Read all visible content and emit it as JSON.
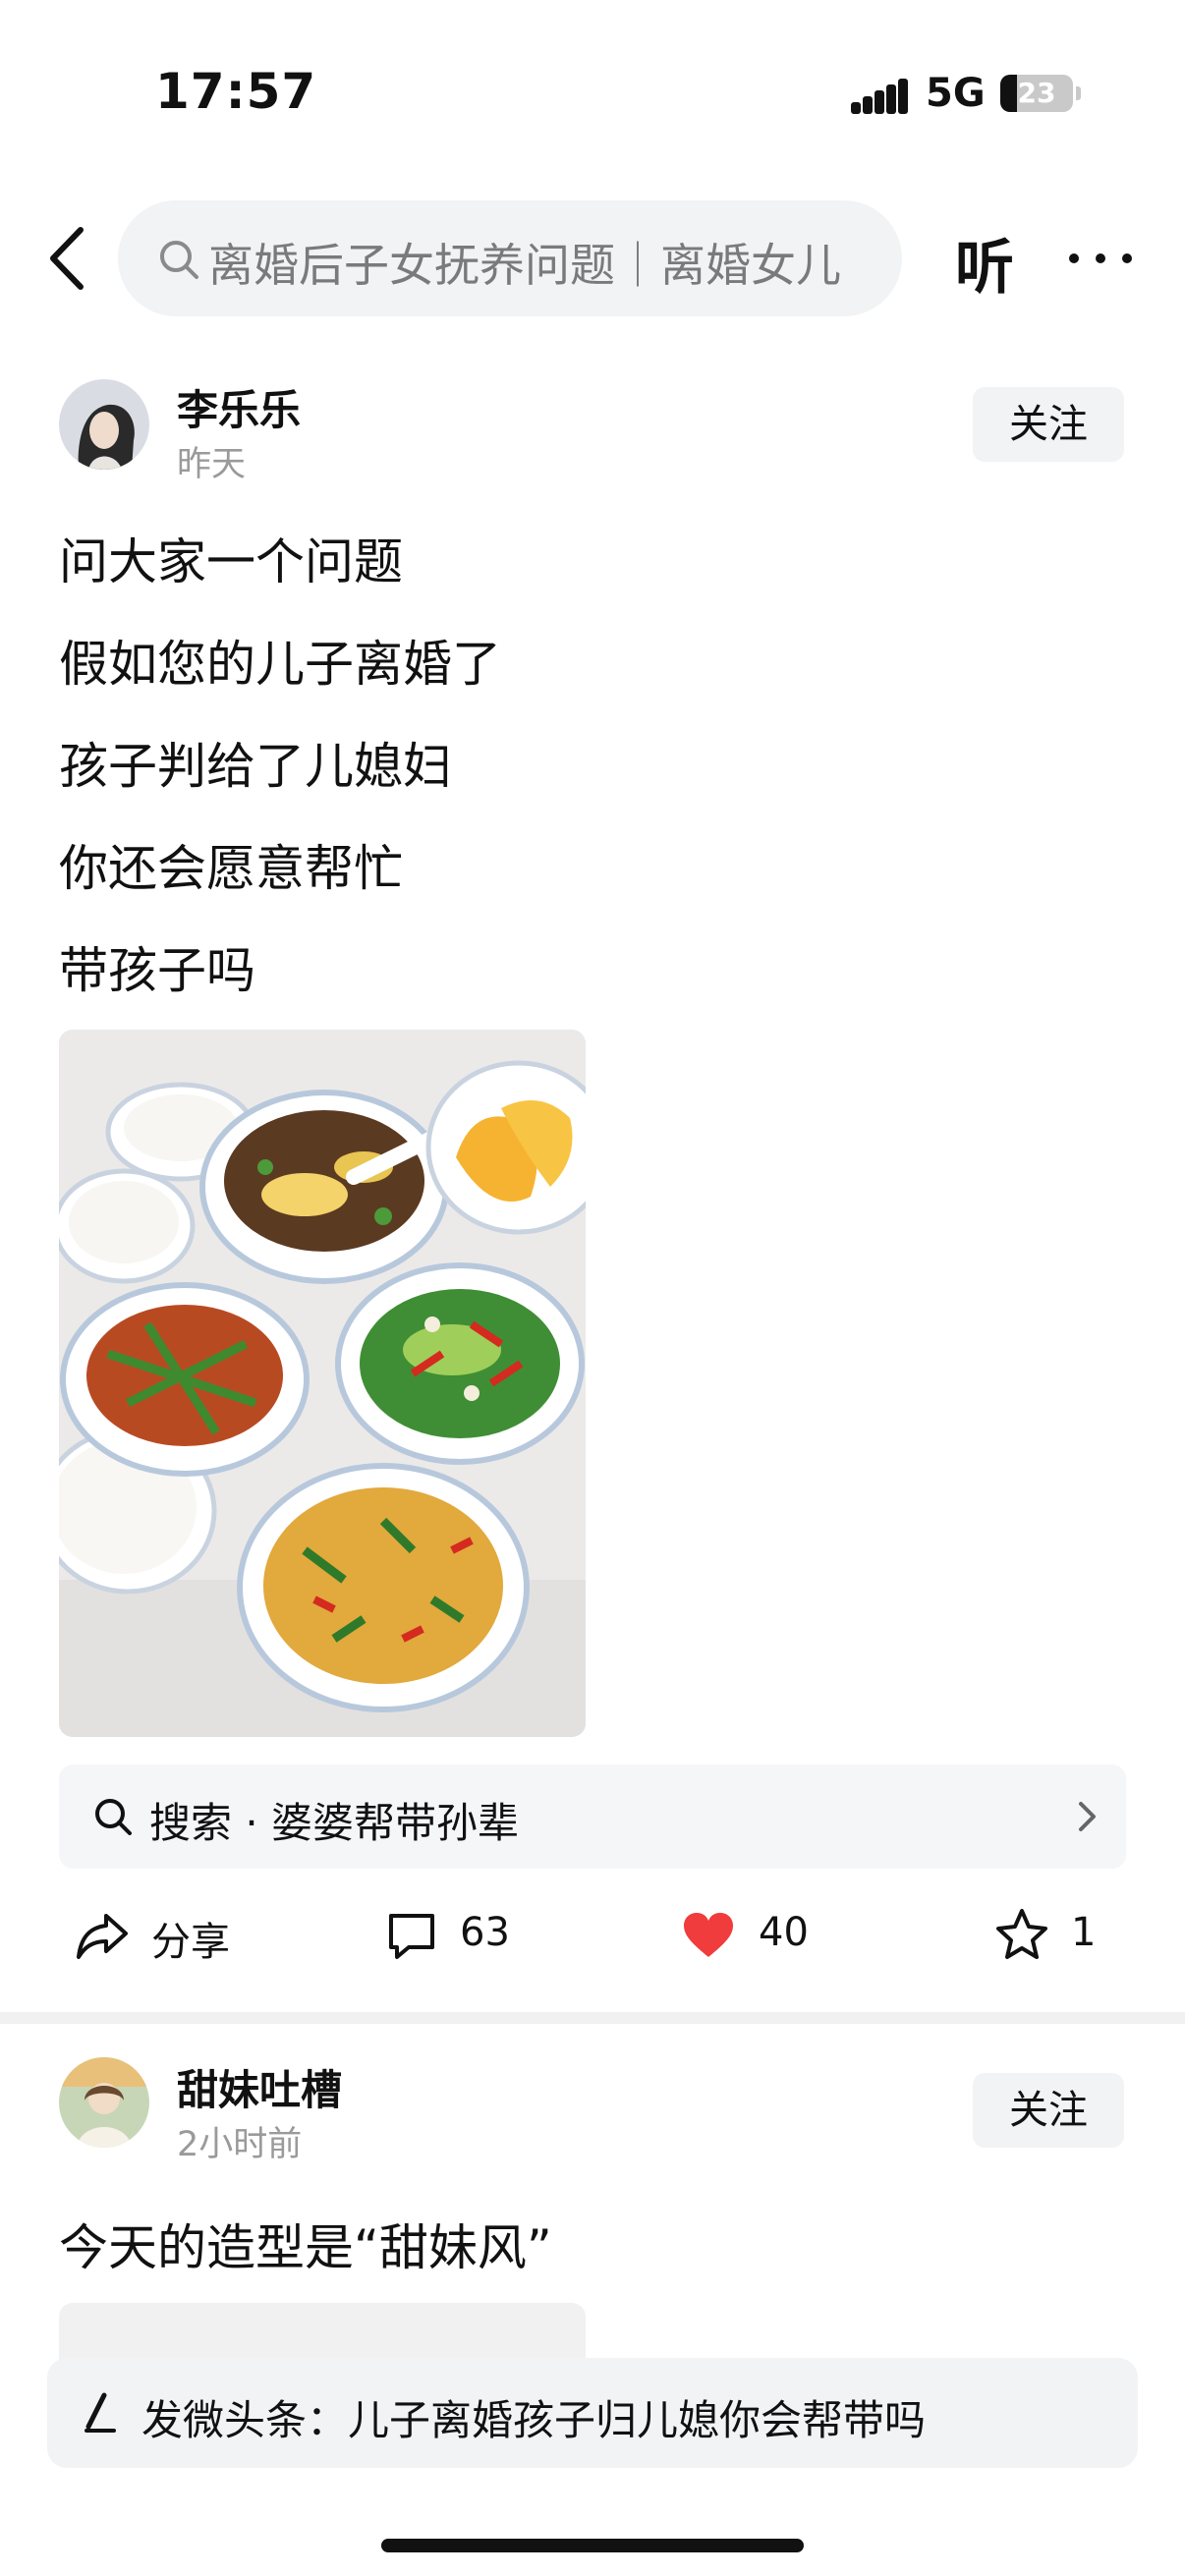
{
  "status_bar": {
    "time": "17:57",
    "network": "5G",
    "battery_level": "23"
  },
  "top_nav": {
    "search_text": "离婚后子女抚养问题｜离婚女儿",
    "listen_label": "听"
  },
  "post1": {
    "author": "李乐乐",
    "time": "昨天",
    "follow_label": "关注",
    "lines": [
      "问大家一个问题",
      "假如您的儿子离婚了",
      "孩子判给了儿媳妇",
      "你还会愿意帮忙",
      "带孩子吗"
    ],
    "related_search": "搜索 · 婆婆帮带孙辈",
    "actions": {
      "share": "分享",
      "comments": "63",
      "likes": "40",
      "favorites": "1"
    }
  },
  "post2": {
    "author": "甜妹吐槽",
    "time": "2小时前",
    "follow_label": "关注",
    "text": "今天的造型是“甜妹风”"
  },
  "compose": {
    "text": "发微头条：儿子离婚孩子归儿媳你会帮带吗"
  },
  "colors": {
    "like": "#f03c3c",
    "muted_text": "#9a9a9a",
    "chip_bg": "#f2f3f5"
  }
}
